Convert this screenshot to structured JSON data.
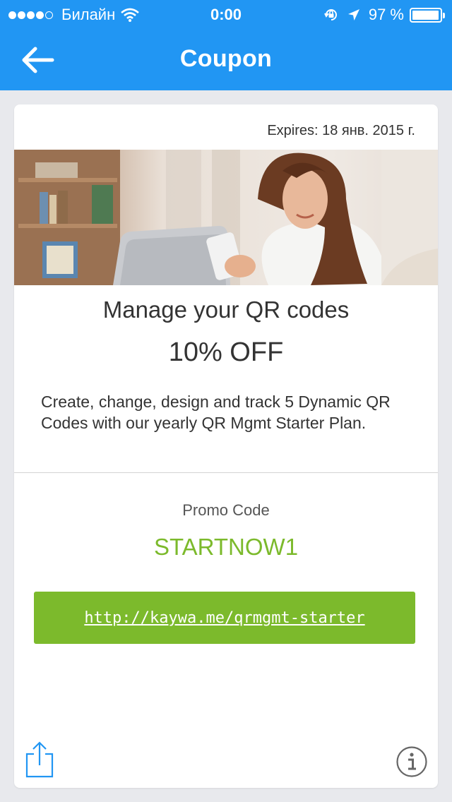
{
  "status_bar": {
    "carrier": "Билайн",
    "time": "0:00",
    "battery_text": "97 %",
    "battery_level": 0.97,
    "signal_bars_filled": 4,
    "signal_bars_total": 5
  },
  "nav": {
    "title": "Coupon",
    "back_icon": "arrow-left-icon"
  },
  "coupon": {
    "expires": "Expires: 18 янв. 2015 г.",
    "headline": "Manage your QR codes",
    "discount": "10% OFF",
    "description": "Create, change, design and track 5 Dynamic QR Codes with our yearly QR Mgmt Starter Plan.",
    "promo_label": "Promo Code",
    "promo_code": "STARTNOW1",
    "link": "http://kaywa.me/qrmgmt-starter"
  },
  "footer": {
    "share_icon": "share-icon",
    "info_icon": "info-icon"
  },
  "colors": {
    "nav_blue": "#2196f3",
    "accent_green": "#7cba2c",
    "background": "#e8e9ed"
  }
}
